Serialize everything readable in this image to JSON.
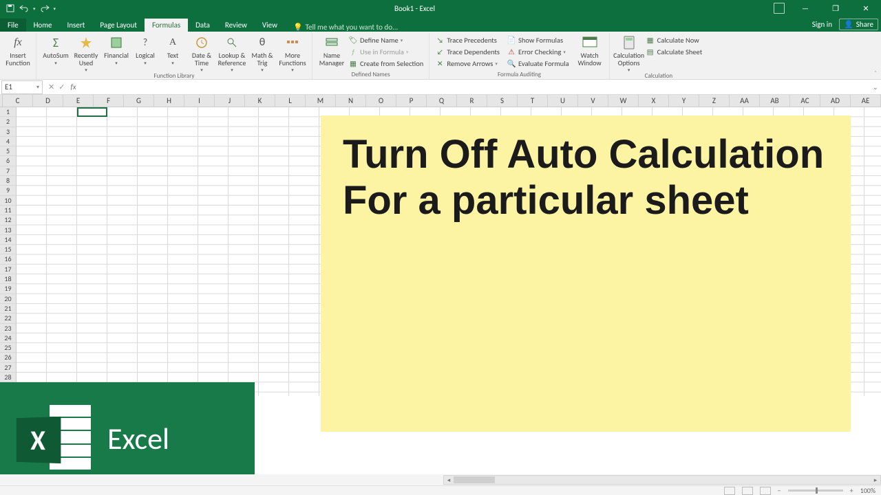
{
  "titlebar": {
    "title": "Book1 - Excel"
  },
  "qat": {
    "save_tip": "Save",
    "undo_tip": "Undo",
    "redo_tip": "Redo"
  },
  "window_ctrl": {
    "ribbon_opts": "Ribbon Display Options",
    "minimize": "Minimize",
    "maximize": "Restore Down",
    "close": "Close"
  },
  "tabs": {
    "file": "File",
    "home": "Home",
    "insert": "Insert",
    "page_layout": "Page Layout",
    "formulas": "Formulas",
    "data": "Data",
    "review": "Review",
    "view": "View",
    "tellme": "Tell me what you want to do..."
  },
  "account": {
    "signin": "Sign in",
    "share": "Share"
  },
  "ribbon": {
    "fx": {
      "insert_function": "Insert\nFunction"
    },
    "lib": {
      "autosum": "AutoSum",
      "recent": "Recently\nUsed",
      "financial": "Financial",
      "logical": "Logical",
      "text": "Text",
      "datetime": "Date &\nTime",
      "lookup": "Lookup &\nReference",
      "mathtrig": "Math &\nTrig",
      "more": "More\nFunctions",
      "group": "Function Library"
    },
    "names": {
      "name_mgr": "Name\nManager",
      "define": "Define Name",
      "use": "Use in Formula",
      "create": "Create from Selection",
      "group": "Defined Names"
    },
    "audit": {
      "precedents": "Trace Precedents",
      "dependents": "Trace Dependents",
      "remove": "Remove Arrows",
      "showf": "Show Formulas",
      "errchk": "Error Checking",
      "eval": "Evaluate Formula",
      "watch": "Watch\nWindow",
      "group": "Formula Auditing"
    },
    "calc": {
      "options": "Calculation\nOptions",
      "now": "Calculate Now",
      "sheet": "Calculate Sheet",
      "group": "Calculation"
    }
  },
  "namebox": {
    "value": "E1"
  },
  "formula_bar": {
    "cancel": "Cancel",
    "enter": "Enter",
    "fx": "fx"
  },
  "columns": [
    "C",
    "D",
    "E",
    "F",
    "G",
    "H",
    "I",
    "J",
    "K",
    "L",
    "M",
    "N",
    "O",
    "P",
    "Q",
    "R",
    "S",
    "T",
    "U",
    "V",
    "W",
    "X",
    "Y",
    "Z",
    "AA",
    "AB",
    "AC",
    "AD",
    "AE"
  ],
  "rows": [
    "1",
    "2",
    "3",
    "4",
    "5",
    "6",
    "7",
    "8",
    "9",
    "10",
    "11",
    "12",
    "13",
    "14",
    "15",
    "16",
    "17",
    "18",
    "19",
    "20",
    "21",
    "22",
    "23",
    "24",
    "25",
    "26",
    "27",
    "28"
  ],
  "overlay": {
    "note": "Turn Off Auto Calculation\nFor a particular sheet",
    "badge_text": "Excel",
    "badge_x": "X"
  },
  "status": {
    "zoom": "100%",
    "minus": "−",
    "plus": "+"
  }
}
